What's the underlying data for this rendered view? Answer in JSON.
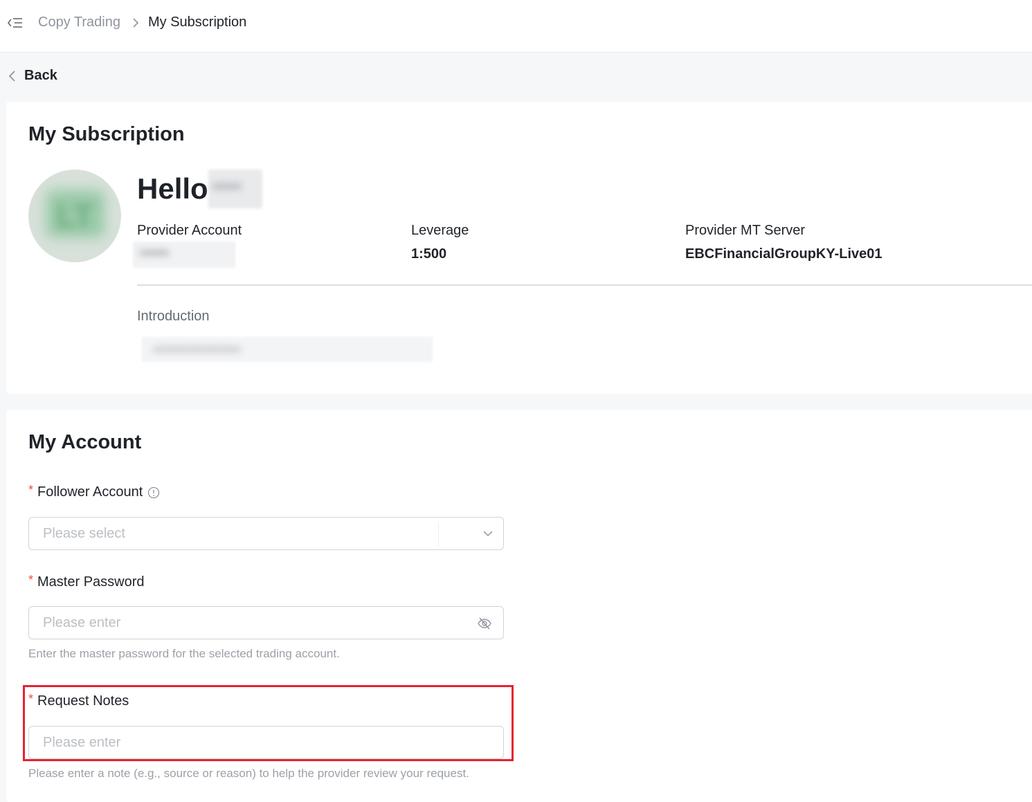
{
  "breadcrumb": {
    "parent": "Copy Trading",
    "current": "My Subscription"
  },
  "back_label": "Back",
  "subscription": {
    "title": "My Subscription",
    "greeting": "Hello",
    "provider_name": "••••",
    "avatar_initials": "LT",
    "fields": {
      "provider_account_label": "Provider Account",
      "provider_account_value": "••••••",
      "leverage_label": "Leverage",
      "leverage_value": "1:500",
      "mt_server_label": "Provider MT Server",
      "mt_server_value": "EBCFinancialGroupKY-Live01"
    },
    "introduction_label": "Introduction",
    "introduction_value": "••••••••••••••••••••"
  },
  "account": {
    "title": "My Account",
    "follower_account": {
      "label": "Follower Account",
      "placeholder": "Please select"
    },
    "master_password": {
      "label": "Master Password",
      "placeholder": "Please enter",
      "help": "Enter the master password for the selected trading account."
    },
    "request_notes": {
      "label": "Request Notes",
      "placeholder": "Please enter",
      "help": "Please enter a note (e.g., source or reason) to help the provider review your request."
    }
  },
  "colors": {
    "required": "#f54a45",
    "highlight": "#e8222e",
    "placeholder": "#bbbfc4",
    "help_text": "#9ca1a8"
  },
  "icons": [
    "menu-collapse-icon",
    "chevron-right-icon",
    "chevron-left-icon",
    "info-circle-icon",
    "chevron-down-icon",
    "eye-off-icon"
  ]
}
